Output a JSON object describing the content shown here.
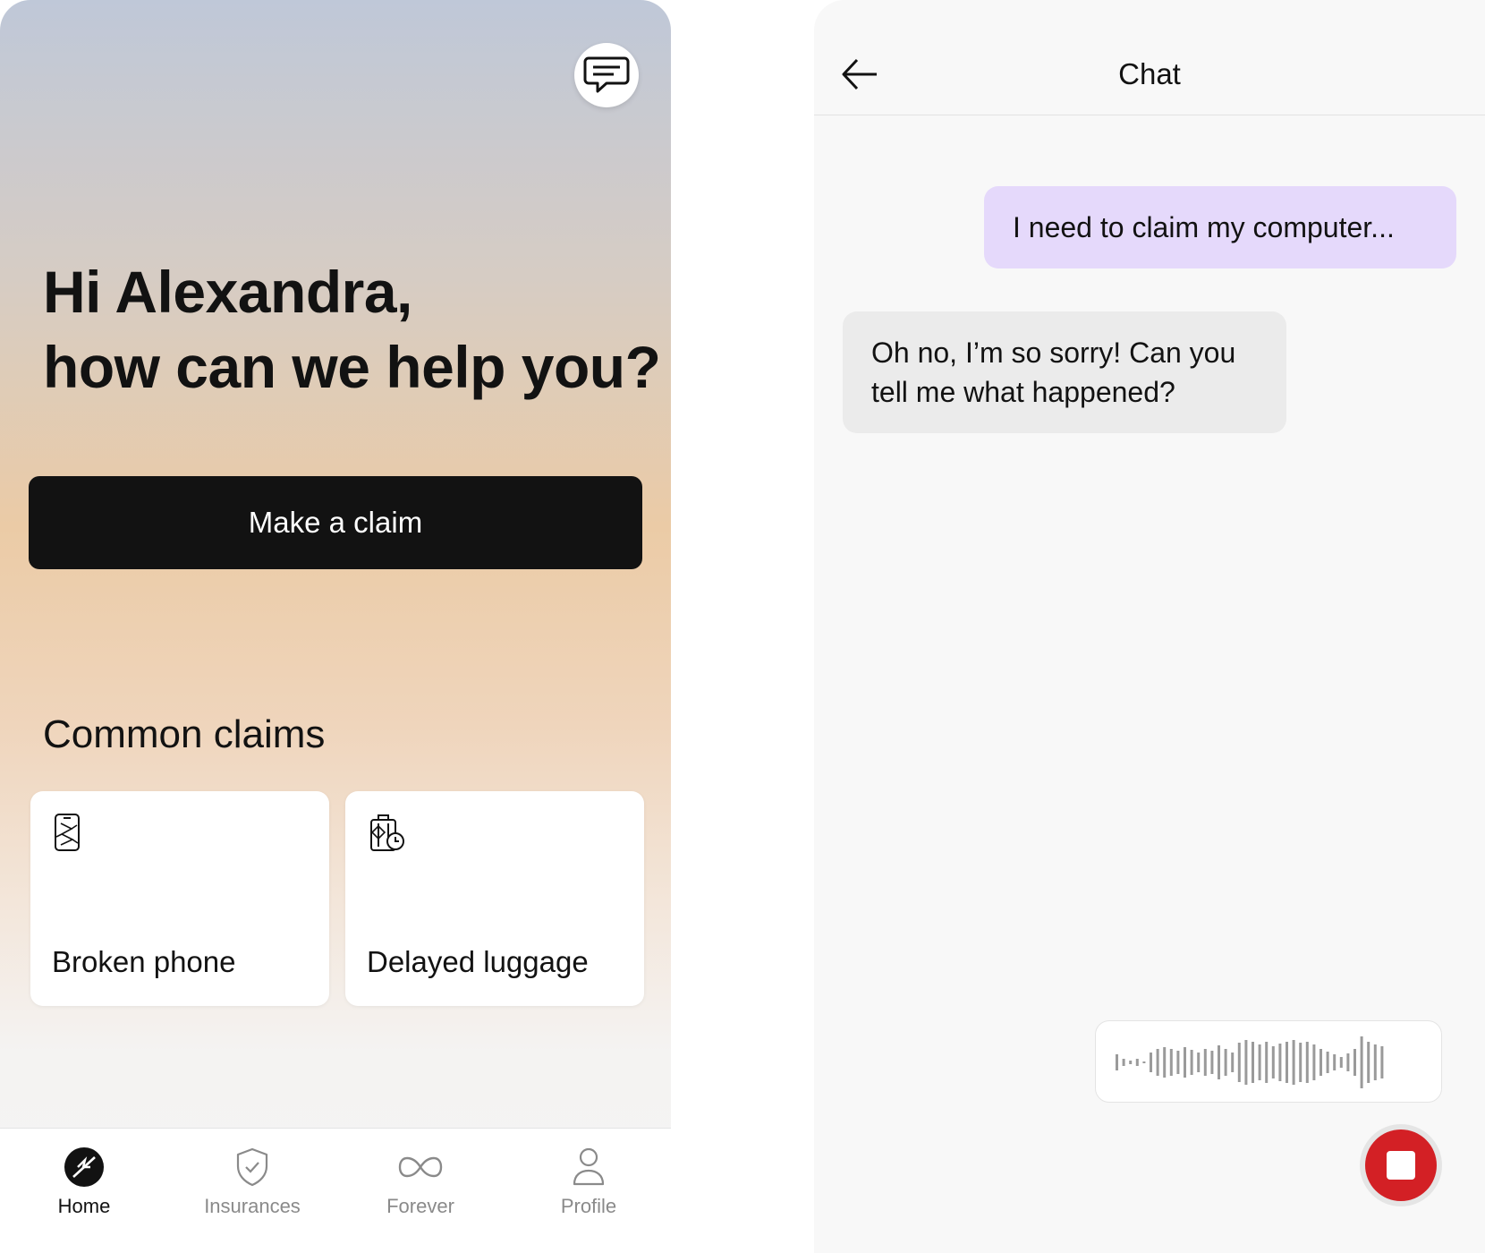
{
  "home": {
    "greeting_line1": "Hi Alexandra,",
    "greeting_line2": "how can we help you?",
    "chat_icon": "chat-bubble-icon",
    "make_claim_label": "Make a claim",
    "common_claims_title": "Common claims",
    "claim_cards": [
      {
        "label": "Broken phone",
        "icon": "broken-phone-icon"
      },
      {
        "label": "Delayed luggage",
        "icon": "delayed-luggage-icon"
      }
    ],
    "nav": [
      {
        "label": "Home",
        "icon": "home-icon",
        "active": true
      },
      {
        "label": "Insurances",
        "icon": "shield-check-icon",
        "active": false
      },
      {
        "label": "Forever",
        "icon": "infinity-icon",
        "active": false
      },
      {
        "label": "Profile",
        "icon": "person-icon",
        "active": false
      }
    ]
  },
  "chat": {
    "title": "Chat",
    "back_icon": "arrow-left-icon",
    "messages": [
      {
        "from": "user",
        "text": "I need to claim my computer..."
      },
      {
        "from": "assistant",
        "text": "Oh no, I’m so sorry! Can you tell me what happened?"
      }
    ],
    "voice_input_icon": "waveform-icon",
    "stop_icon": "stop-icon"
  },
  "colors": {
    "primary_dark": "#121212",
    "user_bubble": "#e5d9fb",
    "assistant_bubble": "#ebebeb",
    "record_red": "#d32025",
    "inactive_nav": "#8a8a8a"
  }
}
